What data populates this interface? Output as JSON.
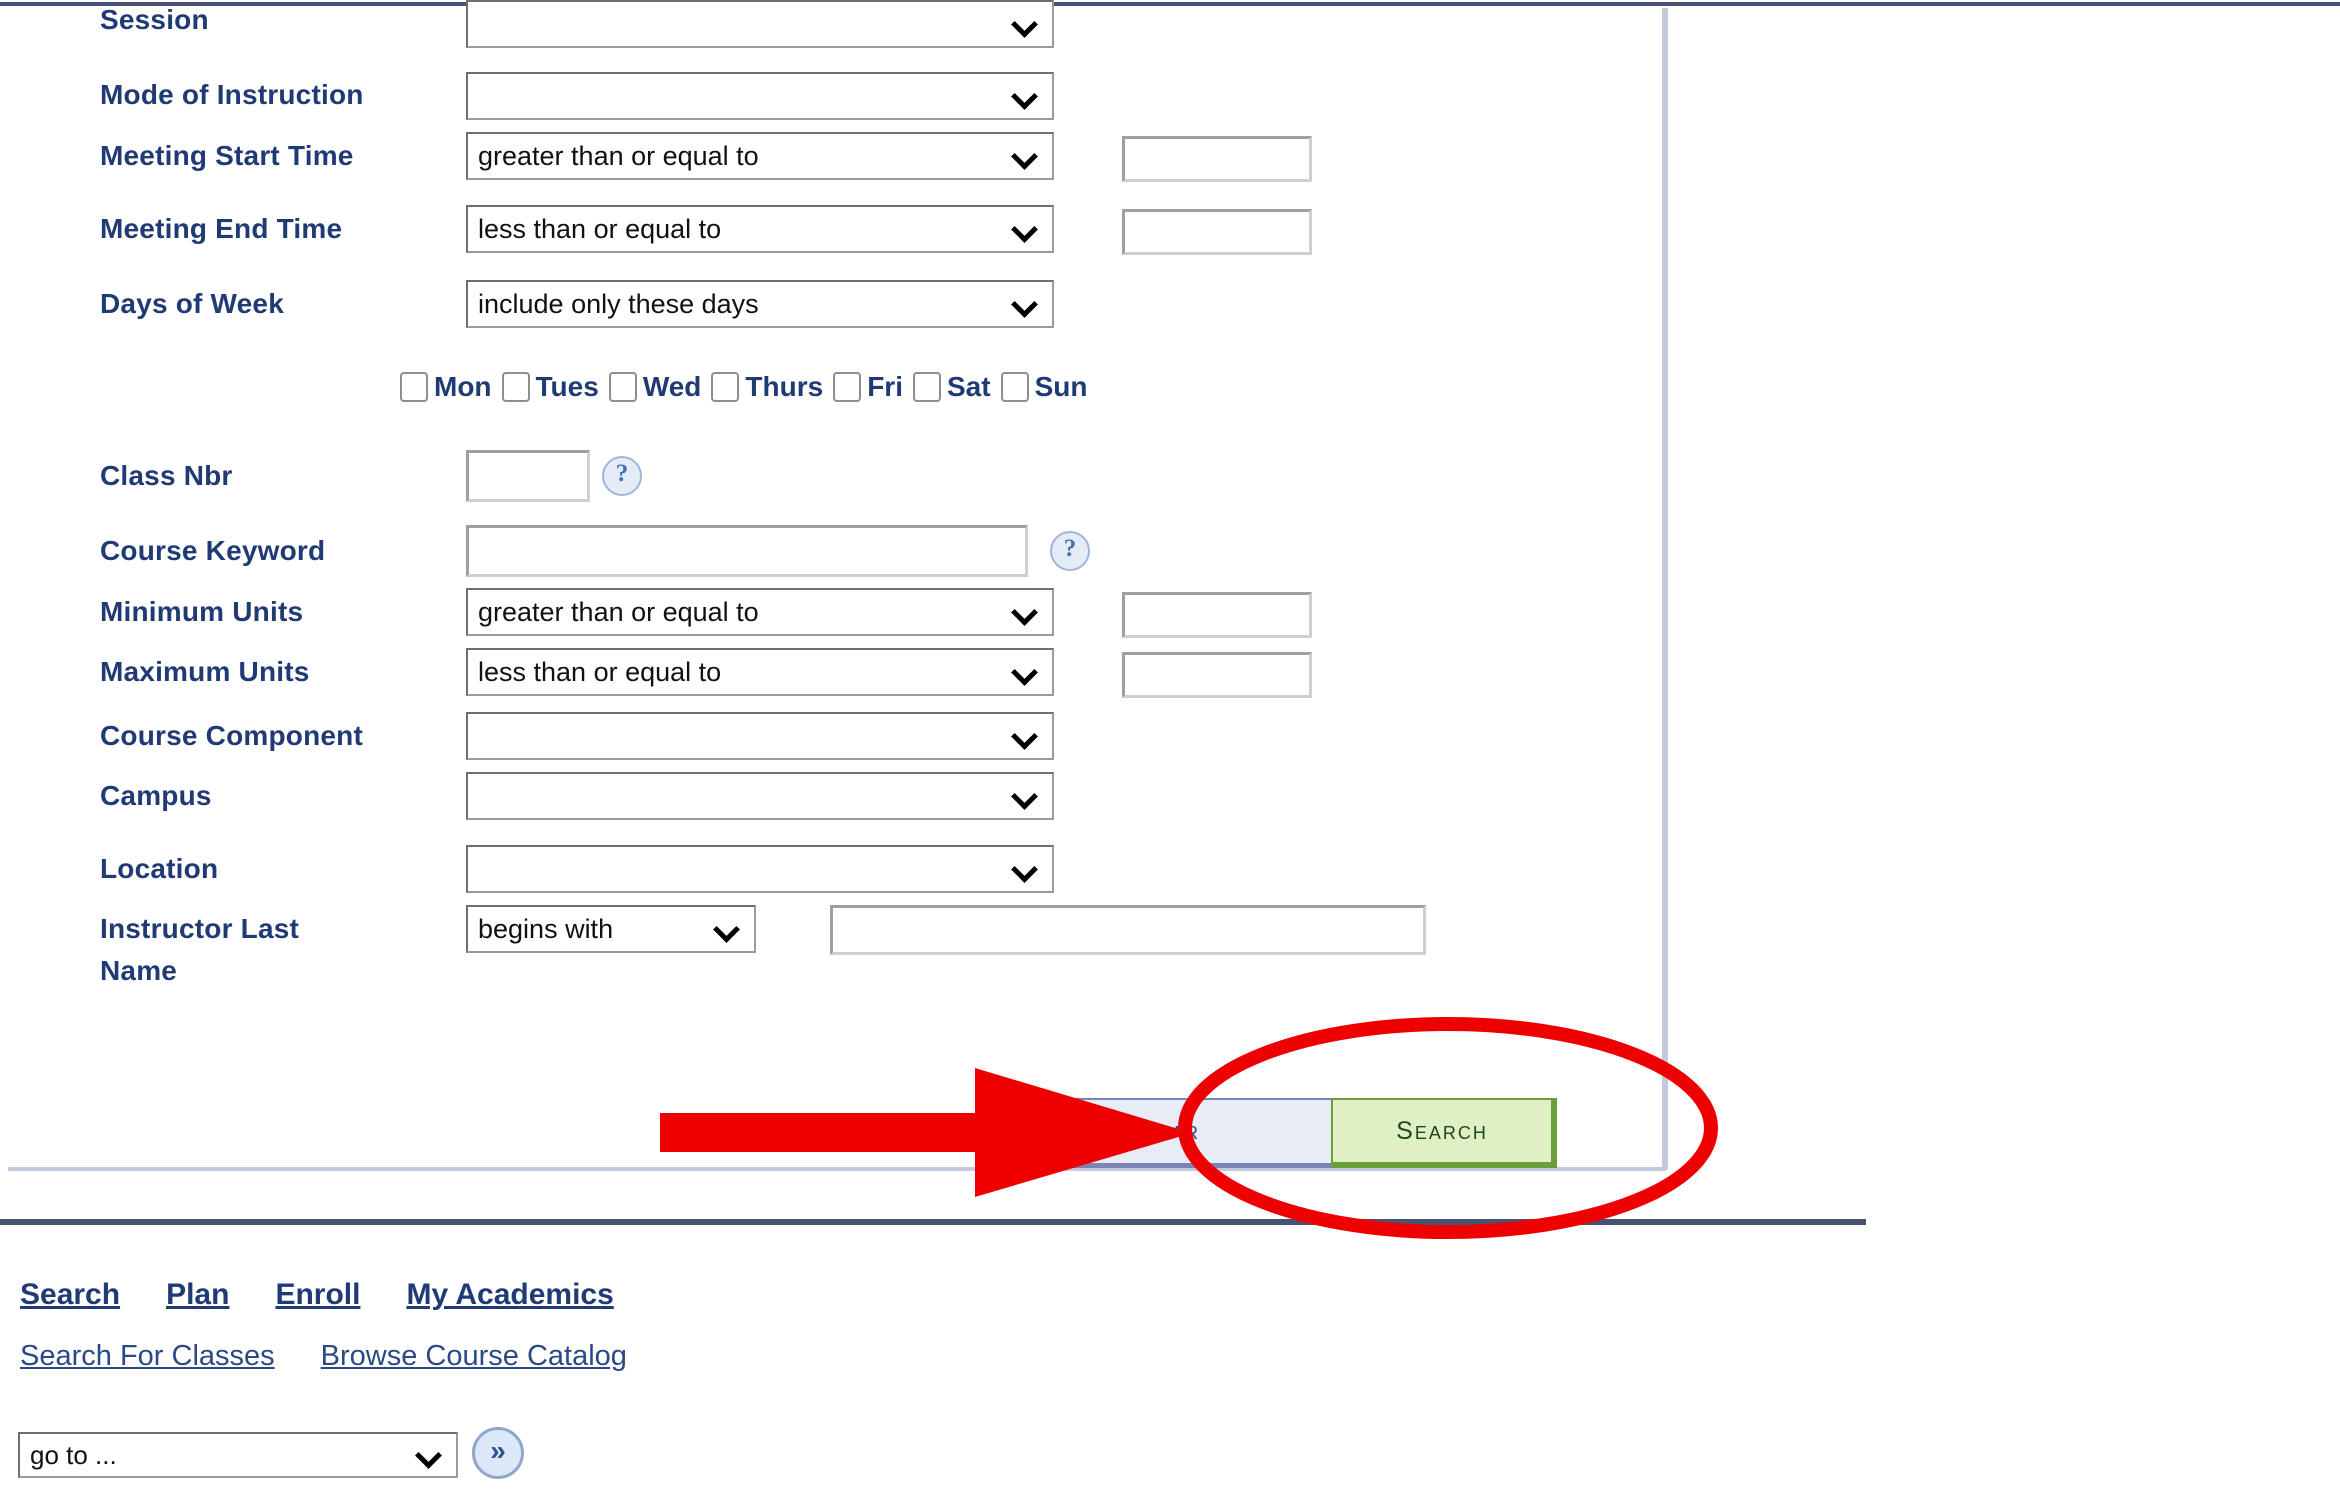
{
  "page": {
    "title": "Search for Classes"
  },
  "form": {
    "rows": [
      {
        "label": "Session",
        "control": "select",
        "value": ""
      },
      {
        "label": "Mode of Instruction",
        "control": "select",
        "value": ""
      },
      {
        "label": "Meeting Start Time",
        "control": "select",
        "value": "greater than or equal to",
        "text_value": ""
      },
      {
        "label": "Meeting End Time",
        "control": "select",
        "value": "less than or equal to",
        "text_value": ""
      },
      {
        "label": "Days of Week",
        "control": "select",
        "value": "include only these days"
      },
      {
        "label": "Class Nbr",
        "control": "text",
        "text_value": "",
        "help": "?"
      },
      {
        "label": "Course Keyword",
        "control": "text",
        "text_value": "",
        "help": "?"
      },
      {
        "label": "Minimum Units",
        "control": "select",
        "value": "greater than or equal to",
        "text_value": ""
      },
      {
        "label": "Maximum Units",
        "control": "select",
        "value": "less than or equal to",
        "text_value": ""
      },
      {
        "label": "Course Component",
        "control": "select",
        "value": ""
      },
      {
        "label": "Campus",
        "control": "select",
        "value": ""
      },
      {
        "label": "Location",
        "control": "select",
        "value": ""
      },
      {
        "label": "Instructor Last Name",
        "control": "select",
        "value": "begins with",
        "text_value": ""
      }
    ],
    "labels": {
      "session": "Session",
      "mode_of_instruction": "Mode of Instruction",
      "meeting_start_time": "Meeting Start Time",
      "meeting_end_time": "Meeting End Time",
      "days_of_week": "Days of Week",
      "class_nbr": "Class Nbr",
      "course_keyword": "Course Keyword",
      "minimum_units": "Minimum Units",
      "maximum_units": "Maximum Units",
      "course_component": "Course Component",
      "campus": "Campus",
      "location": "Location",
      "instructor_last_name_line1": "Instructor Last",
      "instructor_last_name_line2": "Name"
    },
    "values": {
      "session": "",
      "mode_of_instruction": "",
      "meeting_start_time_op": "greater than or equal to",
      "meeting_start_time_val": "",
      "meeting_end_time_op": "less than or equal to",
      "meeting_end_time_val": "",
      "days_of_week_op": "include only these days",
      "class_nbr": "",
      "course_keyword": "",
      "minimum_units_op": "greater than or equal to",
      "minimum_units_val": "",
      "maximum_units_op": "less than or equal to",
      "maximum_units_val": "",
      "course_component": "",
      "campus": "",
      "location": "",
      "instructor_op": "begins with",
      "instructor_val": ""
    },
    "help_glyph": "?",
    "days": [
      {
        "label": "Mon",
        "checked": false
      },
      {
        "label": "Tues",
        "checked": false
      },
      {
        "label": "Wed",
        "checked": false
      },
      {
        "label": "Thurs",
        "checked": false
      },
      {
        "label": "Fri",
        "checked": false
      },
      {
        "label": "Sat",
        "checked": false
      },
      {
        "label": "Sun",
        "checked": false
      }
    ]
  },
  "buttons": {
    "clear": "Clear",
    "search": "Search"
  },
  "annotation": {
    "color": "#ee0000",
    "arrow_target": "Search button area",
    "ellipse_target": "Search button"
  },
  "footer": {
    "primary_links": [
      "Search",
      "Plan",
      "Enroll",
      "My Academics"
    ],
    "secondary_links": [
      "Search For Classes",
      "Browse Course Catalog"
    ],
    "goto": {
      "value": "go to ...",
      "button_glyph": "»"
    }
  },
  "colors": {
    "label_blue": "#1f3a75",
    "rule_navy": "#4a5273",
    "rule_light": "#c3cade",
    "clear_bg": "#e8ecf7",
    "clear_border": "#7a85b5",
    "search_bg": "#dff0c4",
    "search_border": "#6a9e3a",
    "annotation_red": "#ee0000"
  }
}
